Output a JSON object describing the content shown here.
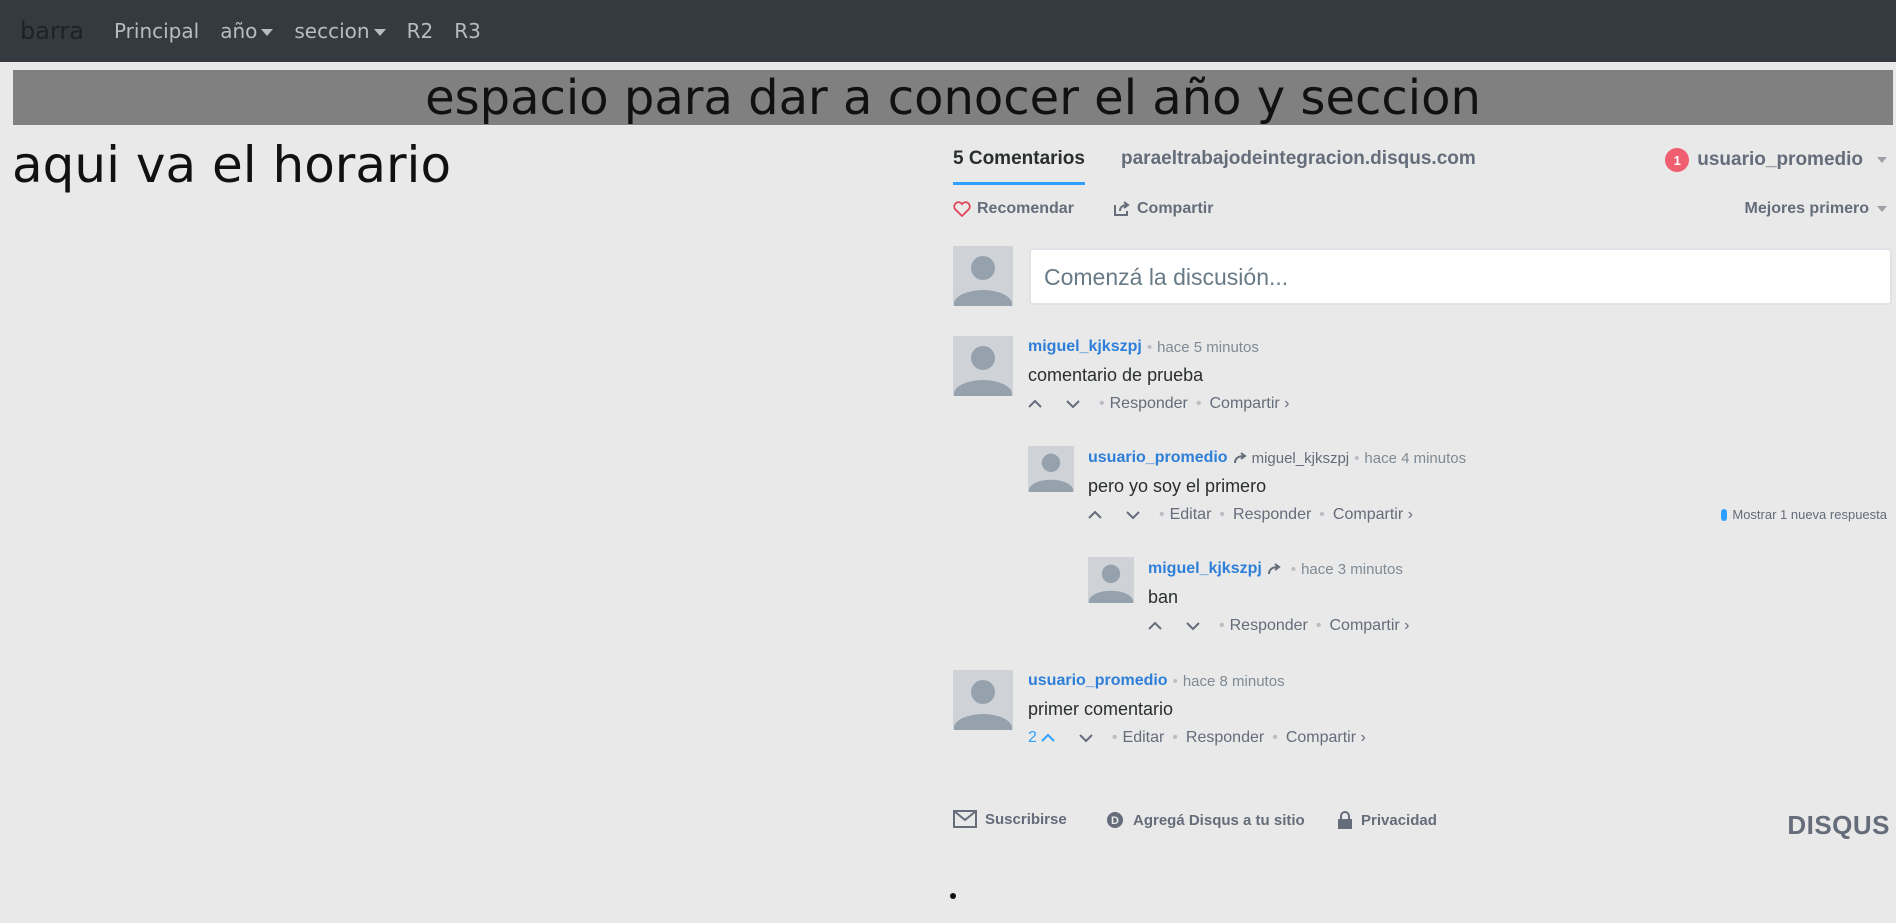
{
  "navbar": {
    "brand": "barra",
    "items": [
      {
        "label": "Principal",
        "dropdown": false
      },
      {
        "label": "año",
        "dropdown": true
      },
      {
        "label": "seccion",
        "dropdown": true
      },
      {
        "label": "R2",
        "dropdown": false
      },
      {
        "label": "R3",
        "dropdown": false
      }
    ]
  },
  "banner": {
    "text": "espacio para dar a conocer el año y seccion"
  },
  "schedule": {
    "text": "aqui va el horario"
  },
  "disqus": {
    "tab_comments": "5 Comentarios",
    "site": "paraeltrabajodeintegracion.disqus.com",
    "user": {
      "name": "usuario_promedio",
      "notifications": "1"
    },
    "recommend": "Recomendar",
    "share": "Compartir",
    "sort": "Mejores primero",
    "composer_placeholder": "Comenzá la discusión...",
    "comments": [
      {
        "author": "miguel_kjkszpj",
        "reply_to": "",
        "time": "hace 5 minutos",
        "body": "comentario de prueba",
        "votes": "",
        "actions": [
          "Responder",
          "Compartir ›"
        ]
      },
      {
        "author": "usuario_promedio",
        "reply_to": "miguel_kjkszpj",
        "time": "hace 4 minutos",
        "body": "pero yo soy el primero",
        "votes": "",
        "actions": [
          "Editar",
          "Responder",
          "Compartir ›"
        ]
      },
      {
        "author": "miguel_kjkszpj",
        "reply_to": "",
        "time": "hace 3 minutos",
        "body": "ban",
        "votes": "",
        "actions": [
          "Responder",
          "Compartir ›"
        ]
      },
      {
        "author": "usuario_promedio",
        "reply_to": "",
        "time": "hace 8 minutos",
        "body": "primer comentario",
        "votes": "2",
        "actions": [
          "Editar",
          "Responder",
          "Compartir ›"
        ]
      }
    ],
    "new_replies": "Mostrar 1 nueva respuesta",
    "footer": {
      "subscribe": "Suscribirse",
      "add_disqus": "Agregá Disqus a tu sitio",
      "privacy": "Privacidad",
      "logo": "DISQUS"
    }
  },
  "colors": {
    "navbar": "#343a40",
    "banner": "#808080",
    "link": "#2e7fd9",
    "accent": "#2e9fff",
    "badge": "#f05f70"
  }
}
